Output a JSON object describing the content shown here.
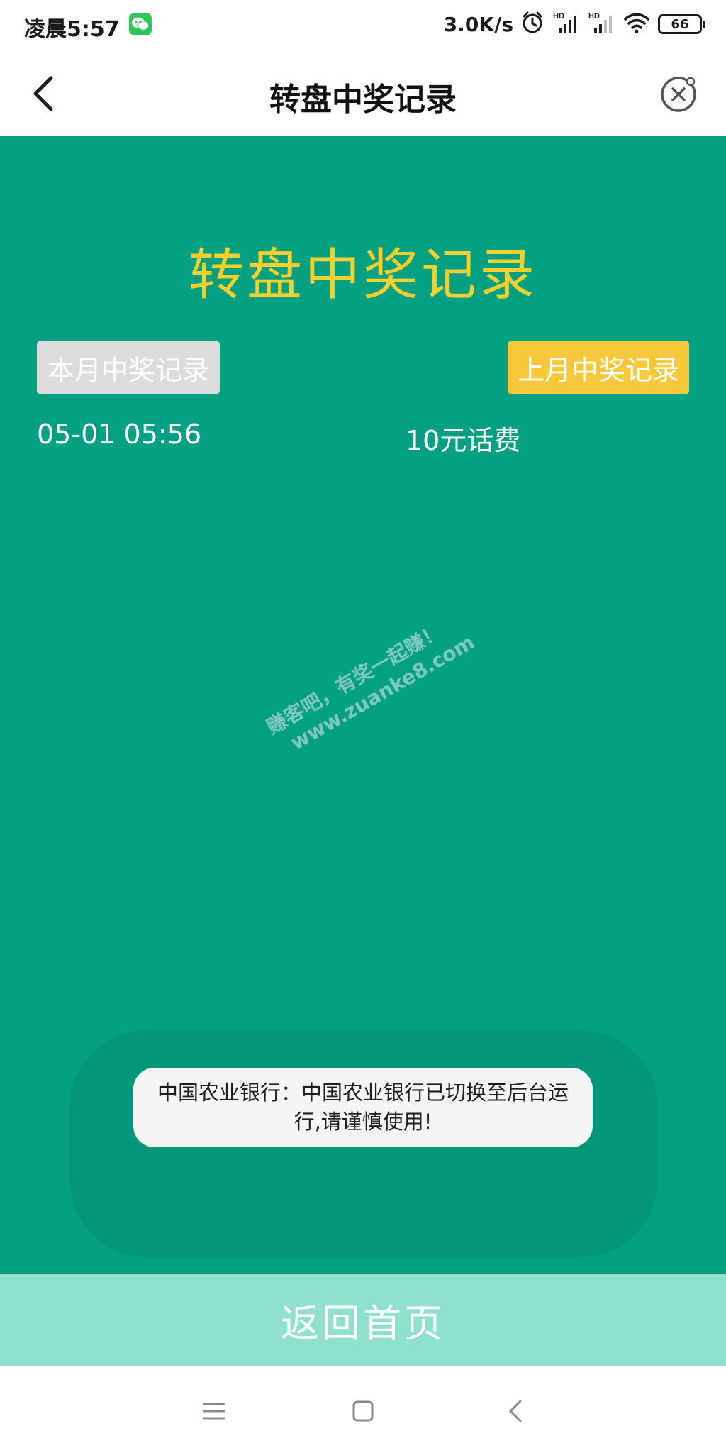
{
  "status_bar": {
    "time": "凌晨5:57",
    "net_speed": "3.0K/s",
    "battery": "66",
    "icons": [
      "wechat-icon",
      "alarm-icon",
      "signal-hd-icon",
      "signal-hd-icon",
      "wifi-icon",
      "battery-icon"
    ]
  },
  "nav": {
    "title": "转盘中奖记录",
    "icons": [
      "back-arrow-icon",
      "close-circle-icon"
    ]
  },
  "main": {
    "heading": "转盘中奖记录",
    "tabs": {
      "this_month": "本月中奖记录",
      "last_month": "上月中奖记录"
    },
    "records": [
      {
        "date": "05-01 05:56",
        "prize": "10元话费"
      }
    ]
  },
  "watermark": {
    "line1": "赚客吧，有奖一起赚！",
    "line2": "www.zuanke8.com"
  },
  "toast": {
    "text": "中国农业银行：中国农业银行已切换至后台运行,请谨慎使用!"
  },
  "footer": {
    "return_button": "返回首页"
  },
  "system_nav": {
    "icons": [
      "menu-icon",
      "home-icon",
      "back-icon"
    ]
  },
  "colors": {
    "main_bg": "#03a182",
    "heading": "#f6d02f",
    "tab_inactive": "#dcdcdc",
    "tab_active": "#f7c93a",
    "return_bg": "#8fe0cd"
  }
}
